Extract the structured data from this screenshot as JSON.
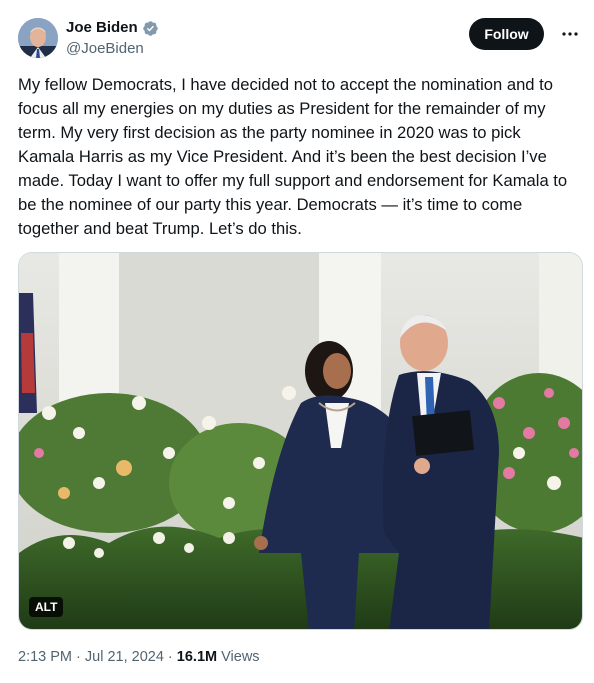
{
  "author": {
    "display_name": "Joe Biden",
    "handle": "@JoeBiden",
    "verified_icon": "verified-badge-icon"
  },
  "actions": {
    "follow_label": "Follow",
    "more_icon": "more-icon"
  },
  "tweet": {
    "text": "My fellow Democrats, I have decided not to accept the nomination and to focus all my energies on my duties as President for the remainder of my term. My very first decision as the party nominee in 2020 was to pick Kamala Harris as my Vice President. And it’s been the best decision I’ve made. Today I want to offer my full support and endorsement for Kamala to be the nominee of our party this year. Democrats — it’s time to come together and beat Trump. Let’s do this."
  },
  "media": {
    "alt_label": "ALT"
  },
  "meta": {
    "timestamp": "2:13 PM · Jul 21, 2024 · ",
    "views_count": "16.1M",
    "views_label": " Views"
  },
  "colors": {
    "verified": "#1d9bf0",
    "button_bg": "#0f1419",
    "secondary_text": "#536471"
  }
}
